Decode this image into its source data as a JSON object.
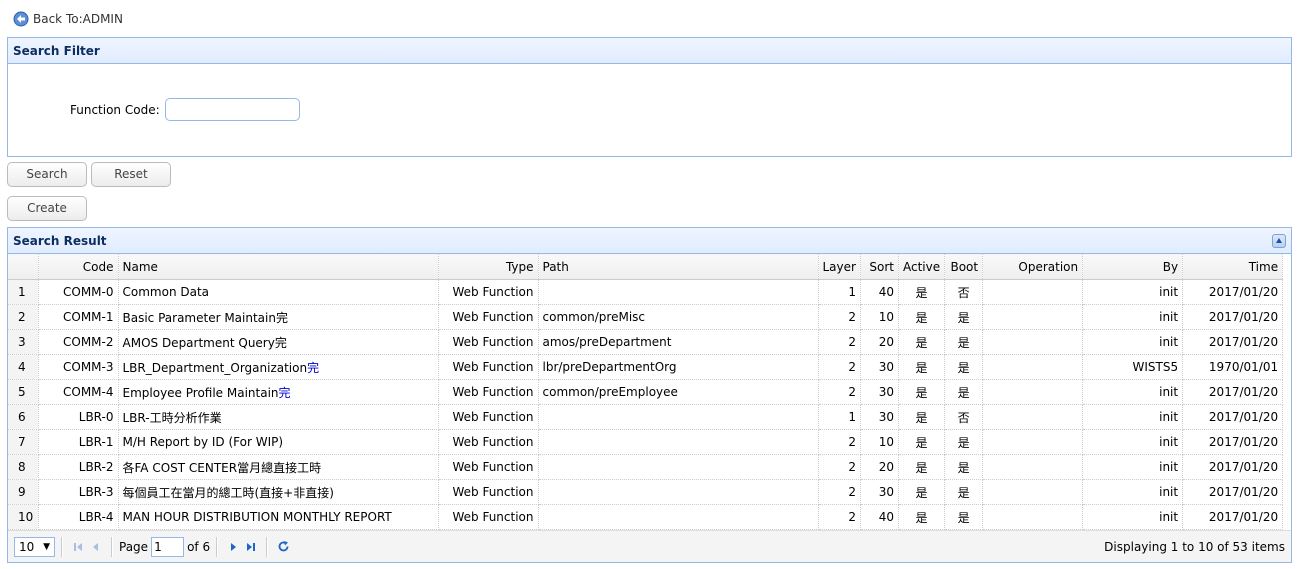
{
  "back_link": "Back To:ADMIN",
  "filter": {
    "title": "Search Filter",
    "function_code_label": "Function Code:",
    "function_code_value": ""
  },
  "buttons": {
    "search": "Search",
    "reset": "Reset",
    "create": "Create"
  },
  "result": {
    "title": "Search Result",
    "columns": [
      "",
      "Code",
      "Name",
      "Type",
      "Path",
      "Layer",
      "Sort",
      "Active",
      "Boot",
      "Operation",
      "By",
      "Time"
    ],
    "rows": [
      {
        "n": "1",
        "code": "COMM-0",
        "name": "Common Data",
        "type": "Web Function",
        "path": "",
        "layer": "1",
        "sort": "40",
        "active": "是",
        "boot": "否",
        "op": "",
        "by": "init",
        "time": "2017/01/20"
      },
      {
        "n": "2",
        "code": "COMM-1",
        "name": "Basic Parameter Maintain完",
        "type": "Web Function",
        "path": "common/preMisc",
        "layer": "2",
        "sort": "10",
        "active": "是",
        "boot": "是",
        "op": "",
        "by": "init",
        "time": "2017/01/20"
      },
      {
        "n": "3",
        "code": "COMM-2",
        "name": "AMOS Department Query完",
        "type": "Web Function",
        "path": "amos/preDepartment",
        "layer": "2",
        "sort": "20",
        "active": "是",
        "boot": "是",
        "op": "",
        "by": "init",
        "time": "2017/01/20"
      },
      {
        "n": "4",
        "code": "COMM-3",
        "name": "LBR_Department_Organization完",
        "type": "Web Function",
        "path": "lbr/preDepartmentOrg",
        "layer": "2",
        "sort": "30",
        "active": "是",
        "boot": "是",
        "op": "",
        "by": "WISTS5",
        "time": "1970/01/01"
      },
      {
        "n": "5",
        "code": "COMM-4",
        "name": "Employee Profile Maintain完",
        "type": "Web Function",
        "path": "common/preEmployee",
        "layer": "2",
        "sort": "30",
        "active": "是",
        "boot": "是",
        "op": "",
        "by": "init",
        "time": "2017/01/20"
      },
      {
        "n": "6",
        "code": "LBR-0",
        "name": "LBR-工時分析作業",
        "type": "Web Function",
        "path": "",
        "layer": "1",
        "sort": "30",
        "active": "是",
        "boot": "否",
        "op": "",
        "by": "init",
        "time": "2017/01/20"
      },
      {
        "n": "7",
        "code": "LBR-1",
        "name": "M/H Report by ID (For WIP)",
        "type": "Web Function",
        "path": "",
        "layer": "2",
        "sort": "10",
        "active": "是",
        "boot": "是",
        "op": "",
        "by": "init",
        "time": "2017/01/20"
      },
      {
        "n": "8",
        "code": "LBR-2",
        "name": "各FA COST CENTER當月總直接工時",
        "type": "Web Function",
        "path": "",
        "layer": "2",
        "sort": "20",
        "active": "是",
        "boot": "是",
        "op": "",
        "by": "init",
        "time": "2017/01/20"
      },
      {
        "n": "9",
        "code": "LBR-3",
        "name": "每個員工在當月的總工時(直接+非直接)",
        "type": "Web Function",
        "path": "",
        "layer": "2",
        "sort": "30",
        "active": "是",
        "boot": "是",
        "op": "",
        "by": "init",
        "time": "2017/01/20"
      },
      {
        "n": "10",
        "code": "LBR-4",
        "name": "MAN HOUR DISTRIBUTION MONTHLY REPORT",
        "type": "Web Function",
        "path": "",
        "layer": "2",
        "sort": "40",
        "active": "是",
        "boot": "是",
        "op": "",
        "by": "init",
        "time": "2017/01/20"
      }
    ]
  },
  "pager": {
    "page_size": "10",
    "page_label": "Page",
    "page_value": "1",
    "of_label": "of 6",
    "info": "Displaying 1 to 10 of 53 items"
  },
  "colors": {
    "border": "#95b8e7",
    "header_text": "#0e2d5f",
    "accent_blue": "#0000cc"
  },
  "icons": [
    "back-arrow-icon",
    "collapse-icon",
    "first-page-icon",
    "prev-page-icon",
    "next-page-icon",
    "last-page-icon",
    "refresh-icon"
  ]
}
